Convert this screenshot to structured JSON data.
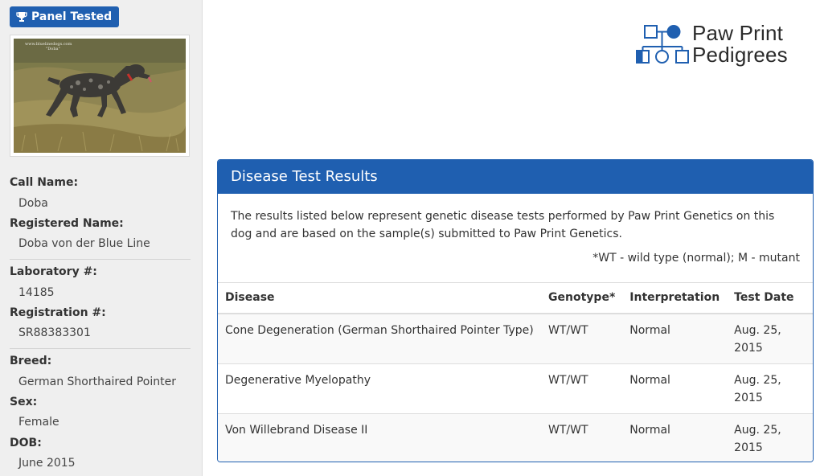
{
  "sidebar": {
    "badge_label": "Panel Tested",
    "photo_caption": "www.bluelinedogs.com\n\"Doba\"",
    "fields": {
      "call_name_label": "Call Name:",
      "call_name": "Doba",
      "registered_name_label": "Registered Name:",
      "registered_name": "Doba von der Blue Line",
      "lab_label": "Laboratory #:",
      "lab_number": "14185",
      "registration_label": "Registration #:",
      "registration_number": "SR88383301",
      "breed_label": "Breed:",
      "breed": "German Shorthaired Pointer",
      "sex_label": "Sex:",
      "sex": "Female",
      "dob_label": "DOB:",
      "dob": "June 2015"
    }
  },
  "logo": {
    "line1": "Paw Print",
    "line2": "Pedigrees"
  },
  "panel": {
    "title": "Disease Test Results",
    "description": "The results listed below represent genetic disease tests performed by Paw Print Genetics on this dog and are based on the sample(s) submitted to Paw Print Genetics.",
    "note": "*WT - wild type (normal); M - mutant",
    "columns": [
      "Disease",
      "Genotype*",
      "Interpretation",
      "Test Date"
    ],
    "rows": [
      {
        "disease": "Cone Degeneration (German Shorthaired Pointer Type)",
        "genotype": "WT/WT",
        "interpretation": "Normal",
        "date": "Aug. 25, 2015"
      },
      {
        "disease": "Degenerative Myelopathy",
        "genotype": "WT/WT",
        "interpretation": "Normal",
        "date": "Aug. 25, 2015"
      },
      {
        "disease": "Von Willebrand Disease II",
        "genotype": "WT/WT",
        "interpretation": "Normal",
        "date": "Aug. 25, 2015"
      }
    ]
  },
  "colors": {
    "accent": "#1f5fb0",
    "sidebar_bg": "#efefef",
    "row_alt": "#f9f9f9"
  },
  "icons": {
    "badge": "trophy-icon",
    "logo": "pedigree-chart-icon"
  }
}
